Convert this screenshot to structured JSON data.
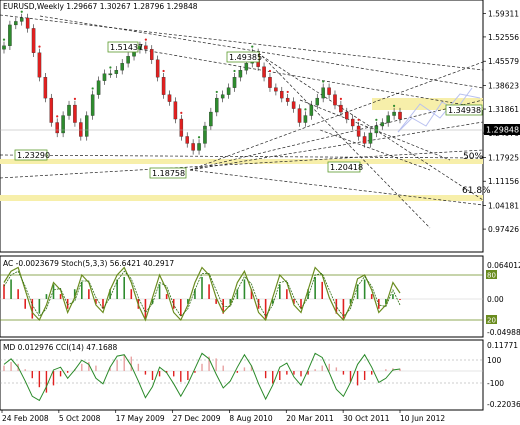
{
  "window_title": "EURUSD,Weekly  1.29667 1.30267 1.28796 1.29848",
  "chart_data": [
    {
      "type": "candlestick",
      "symbol": "EURUSD",
      "timeframe": "Weekly",
      "ohlc": {
        "open": 1.29667,
        "high": 1.30267,
        "low": 1.28796,
        "close": 1.29848
      },
      "current_price": "1.29848",
      "ylim": [
        0.92,
        1.62
      ],
      "y_ticks": [
        "1.59311",
        "1.52556",
        "1.45579",
        "1.38623",
        "1.31861",
        "1.24970",
        "1.17925",
        "1.11156",
        "1.04181",
        "0.97426"
      ],
      "x_ticks": [
        "24 Feb 2008",
        "5 Oct 2008",
        "17 May 2009",
        "27 Dec 2009",
        "8 Aug 2010",
        "20 Mar 2011",
        "30 Oct 2011",
        "10 Jun 2012"
      ],
      "price_labels": [
        "1.51437",
        "1.49385",
        "1.23290",
        "1.18758",
        "1.20418",
        "1.34938"
      ],
      "fib_labels": [
        "50%",
        "61.8%"
      ],
      "support_resistance_levels": [
        1.2116,
        1.117,
        1.349
      ],
      "close_series": [
        1.5,
        1.56,
        1.57,
        1.58,
        1.55,
        1.48,
        1.41,
        1.35,
        1.28,
        1.25,
        1.3,
        1.33,
        1.28,
        1.24,
        1.3,
        1.36,
        1.4,
        1.42,
        1.42,
        1.43,
        1.45,
        1.47,
        1.49,
        1.5,
        1.49,
        1.46,
        1.41,
        1.36,
        1.34,
        1.29,
        1.24,
        1.22,
        1.2,
        1.22,
        1.27,
        1.31,
        1.35,
        1.36,
        1.38,
        1.41,
        1.43,
        1.45,
        1.48,
        1.44,
        1.41,
        1.38,
        1.37,
        1.35,
        1.34,
        1.32,
        1.28,
        1.3,
        1.33,
        1.35,
        1.38,
        1.36,
        1.33,
        1.31,
        1.29,
        1.27,
        1.24,
        1.22,
        1.25,
        1.27,
        1.28,
        1.3,
        1.31,
        1.29
      ]
    },
    {
      "type": "line",
      "title": "AC -0.0023679  Stoch(5,3,3) 56.6421 40.2917",
      "y_ticks": [
        "0.0640123",
        "0.00",
        "-0.04988"
      ],
      "stoch_levels": [
        "80",
        "20"
      ],
      "series": [
        {
          "values": [
            70,
            85,
            90,
            60,
            30,
            20,
            40,
            70,
            60,
            30,
            50,
            80,
            70,
            40,
            30,
            60,
            80,
            90,
            70,
            40,
            20,
            50,
            80,
            60,
            30,
            20,
            40,
            70,
            90,
            80,
            50,
            30,
            40,
            70,
            85,
            60,
            30,
            20,
            50,
            80,
            70,
            40,
            30,
            60,
            90,
            80,
            50,
            30,
            20,
            40,
            75,
            80,
            60,
            30,
            40,
            70,
            56
          ]
        },
        {
          "values": [
            65,
            80,
            85,
            65,
            40,
            25,
            35,
            60,
            62,
            40,
            45,
            72,
            72,
            50,
            35,
            50,
            72,
            85,
            75,
            50,
            30,
            42,
            70,
            65,
            40,
            25,
            35,
            60,
            82,
            82,
            60,
            38,
            38,
            60,
            78,
            68,
            42,
            25,
            40,
            70,
            72,
            50,
            35,
            50,
            80,
            82,
            60,
            38,
            25,
            35,
            65,
            78,
            65,
            40,
            38,
            60,
            40
          ]
        }
      ],
      "histogram": [
        0.03,
        0.04,
        0.02,
        -0.02,
        -0.04,
        -0.03,
        0.01,
        0.03,
        0.01,
        -0.02,
        0.02,
        0.035,
        0.02,
        -0.01,
        -0.02,
        0.02,
        0.04,
        0.045,
        0.02,
        -0.02,
        -0.04,
        -0.01,
        0.03,
        0.01,
        -0.02,
        -0.035,
        -0.01,
        0.02,
        0.045,
        0.03,
        -0.01,
        -0.03,
        -0.01,
        0.02,
        0.04,
        0.02,
        -0.02,
        -0.04,
        -0.01,
        0.03,
        0.02,
        -0.01,
        -0.02,
        0.02,
        0.045,
        0.035,
        0.0,
        -0.03,
        -0.04,
        -0.01,
        0.03,
        0.04,
        0.01,
        -0.02,
        -0.01,
        0.01,
        -0.002
      ]
    },
    {
      "type": "line",
      "title": "MD 0.012976  CCI(14) 47.1688",
      "y_ticks": [
        "0.11771",
        "100",
        "-100",
        "-0.22036"
      ],
      "series": [
        {
          "values": [
            80,
            120,
            60,
            -40,
            -150,
            -180,
            -80,
            40,
            60,
            -20,
            40,
            110,
            80,
            -20,
            -60,
            60,
            140,
            150,
            70,
            -40,
            -160,
            -80,
            60,
            20,
            -60,
            -150,
            -60,
            50,
            160,
            120,
            10,
            -90,
            -40,
            60,
            150,
            70,
            -60,
            -170,
            -70,
            60,
            90,
            -10,
            -70,
            40,
            160,
            130,
            20,
            -100,
            -150,
            -50,
            80,
            150,
            60,
            -50,
            -20,
            40,
            47
          ]
        }
      ],
      "histogram": [
        0.03,
        0.05,
        0.04,
        0.01,
        -0.04,
        -0.09,
        -0.12,
        -0.08,
        -0.03,
        -0.01,
        0.01,
        0.04,
        0.05,
        0.03,
        0.0,
        0.02,
        0.06,
        0.09,
        0.08,
        0.04,
        -0.02,
        -0.05,
        -0.03,
        -0.01,
        -0.03,
        -0.06,
        -0.05,
        -0.01,
        0.04,
        0.08,
        0.07,
        0.03,
        0.0,
        -0.01,
        0.02,
        0.03,
        0.0,
        -0.04,
        -0.07,
        -0.05,
        -0.02,
        -0.02,
        -0.03,
        -0.02,
        0.01,
        0.03,
        0.04,
        0.02,
        -0.02,
        -0.06,
        -0.08,
        -0.05,
        -0.02,
        0.0,
        0.01,
        0.015,
        0.013
      ]
    }
  ],
  "colors": {
    "bull": "#2e8b2e",
    "bear": "#e02020",
    "zone": "#f7efaa",
    "axis": "#333333",
    "stoch_main": "#6a8c1f",
    "stoch_signal": "#2c6e12",
    "cci": "#2a8a2a",
    "label_border": "#5a9a2a",
    "price_box": "#000000"
  }
}
